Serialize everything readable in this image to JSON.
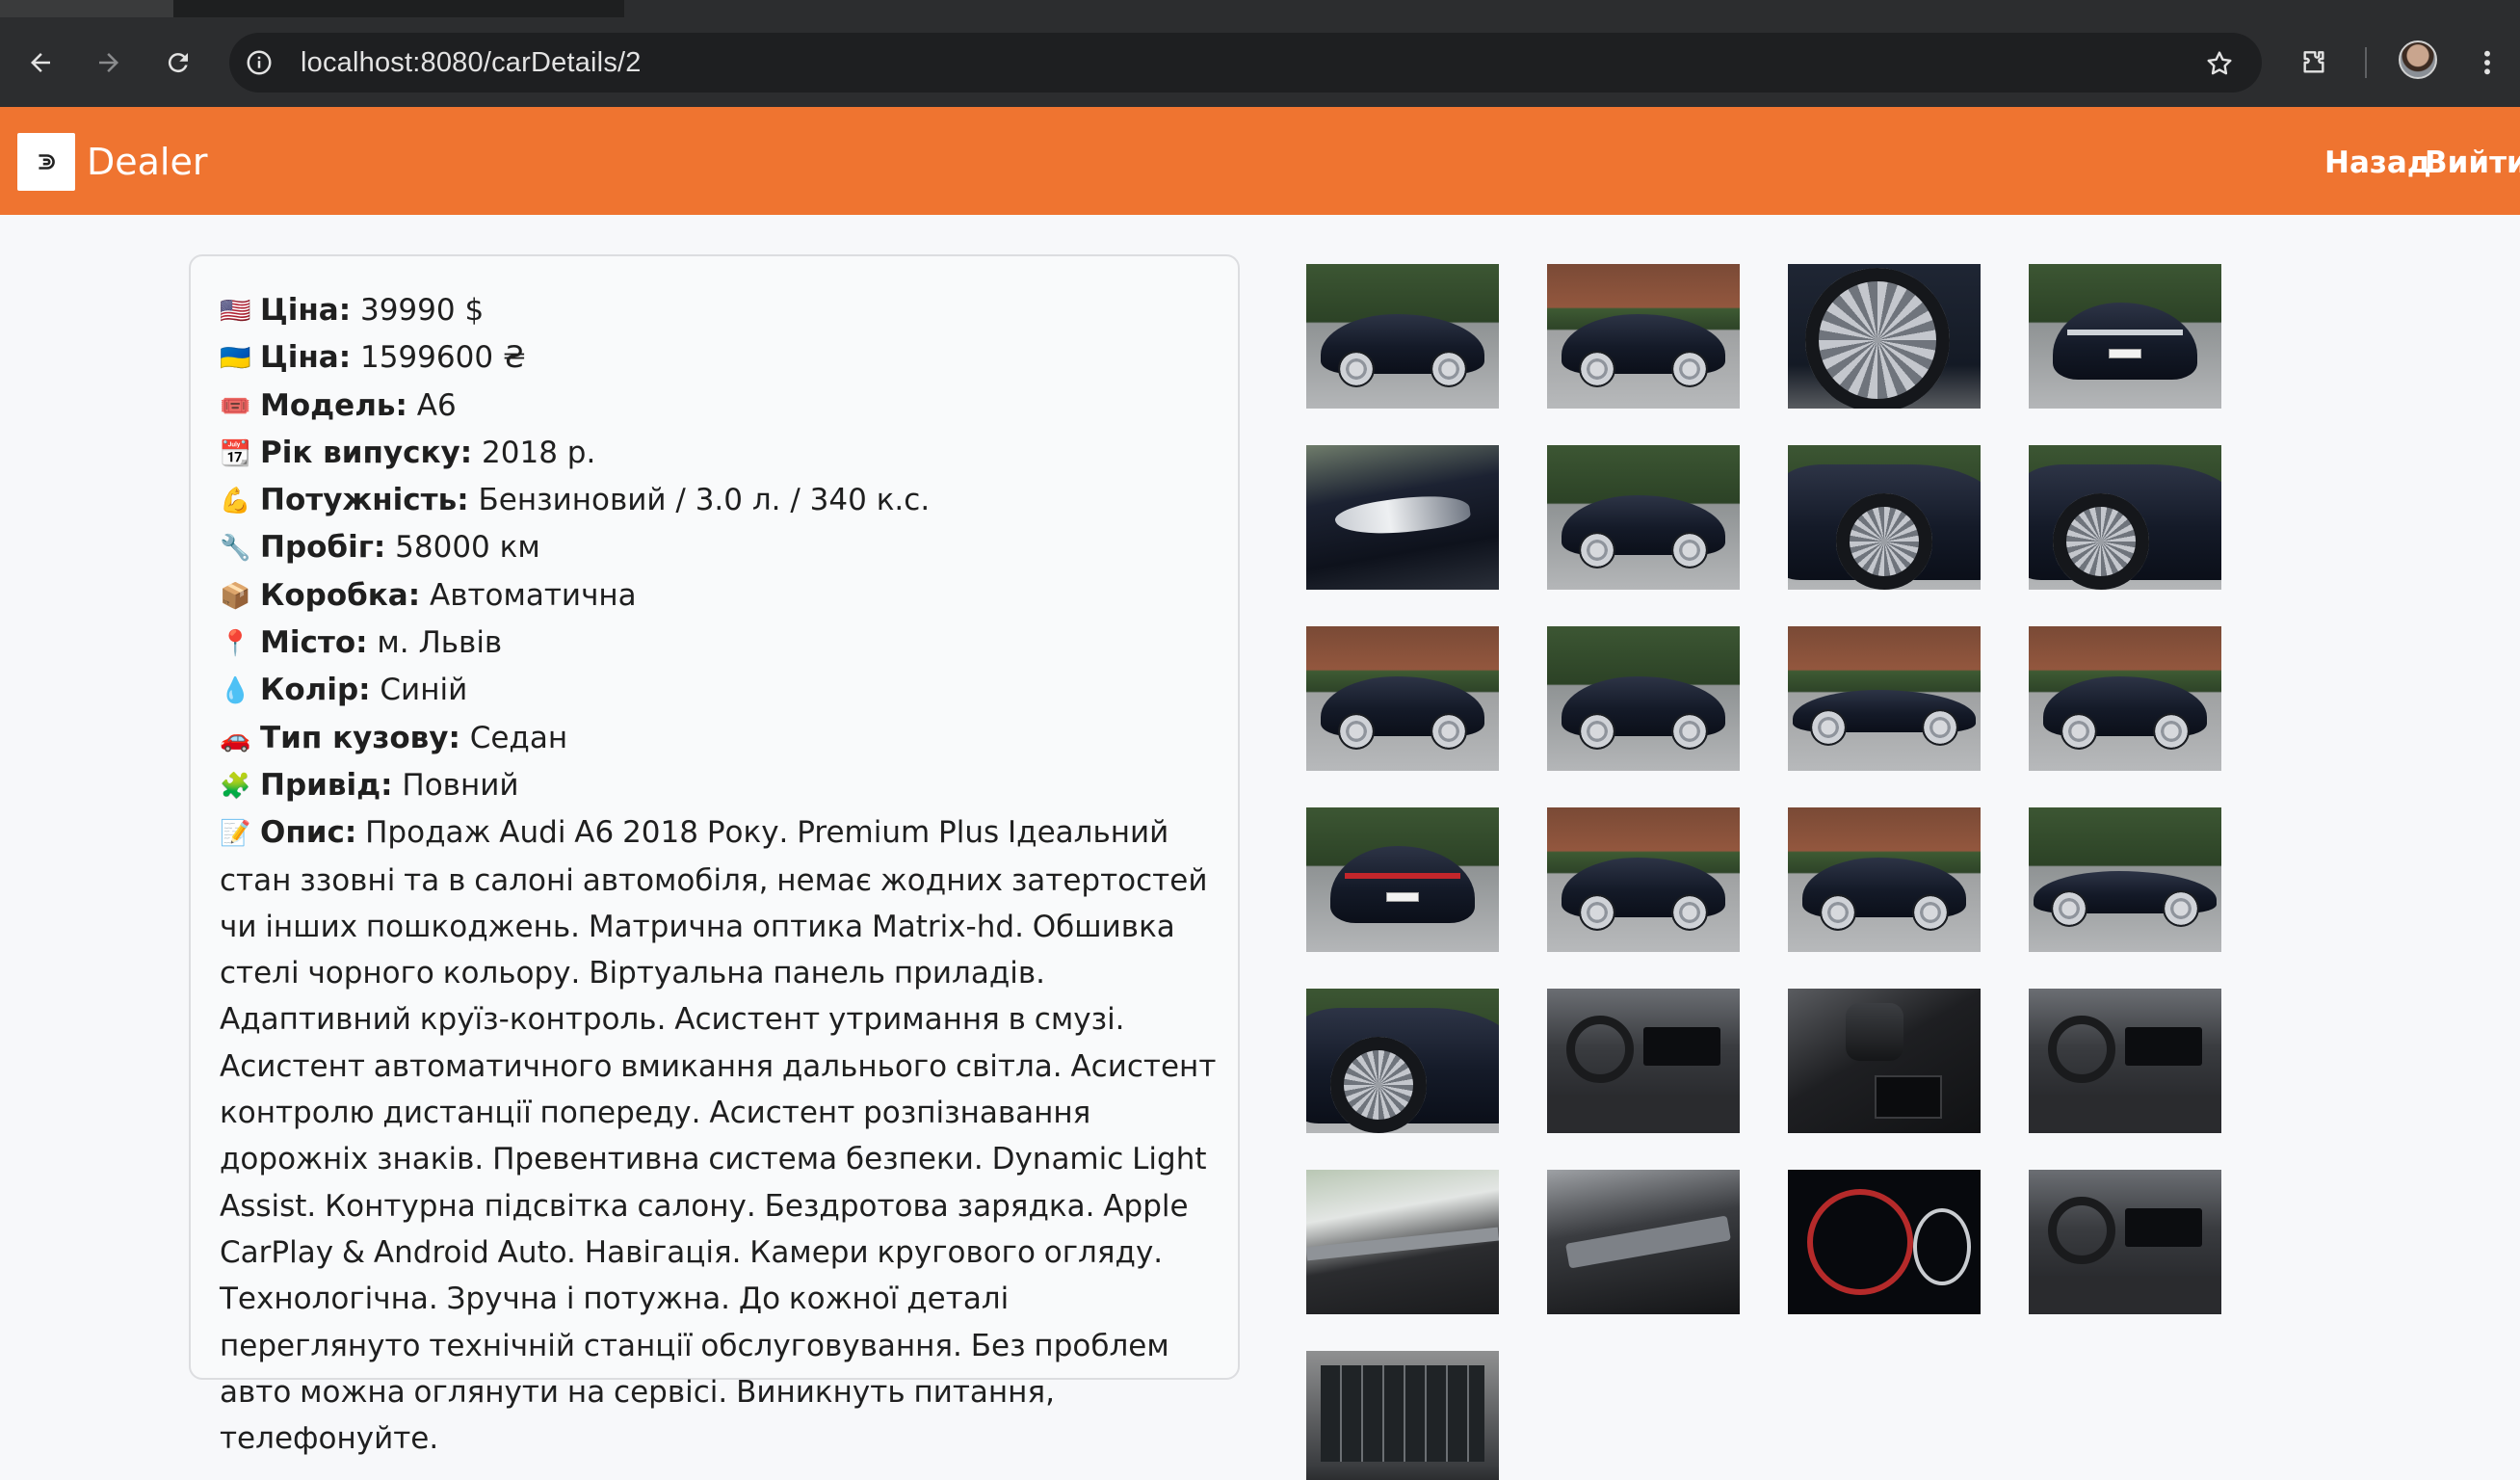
{
  "browser": {
    "url": "localhost:8080/carDetails/2"
  },
  "header": {
    "brand": "Dealer",
    "back_label": "Назад",
    "logout_label": "Вийти"
  },
  "details": {
    "rows": [
      {
        "emoji": "🇺🇸",
        "label": "Ціна:",
        "value": " 39990 $"
      },
      {
        "emoji": "🇺🇦",
        "label": "Ціна:",
        "value": " 1599600 ₴"
      },
      {
        "emoji": "🎟️",
        "label": "Модель:",
        "value": " A6"
      },
      {
        "emoji": "📆",
        "label": "Рік випуску:",
        "value": " 2018 р."
      },
      {
        "emoji": "💪",
        "label": "Потужність:",
        "value": " Бензиновий / 3.0 л. / 340 к.с."
      },
      {
        "emoji": "🔧",
        "label": "Пробіг:",
        "value": " 58000 км"
      },
      {
        "emoji": "📦",
        "label": "Коробка:",
        "value": " Автоматична"
      },
      {
        "emoji": "📍",
        "label": "Місто:",
        "value": " м. Львів"
      },
      {
        "emoji": "💧",
        "label": "Колір:",
        "value": " Синій"
      },
      {
        "emoji": "🚗",
        "label": "Тип кузову:",
        "value": " Седан"
      },
      {
        "emoji": "🧩",
        "label": "Привід:",
        "value": " Повний"
      }
    ],
    "description": {
      "emoji": "📝",
      "label": "Опис:",
      "value": " Продаж Audi A6 2018 Року. Premium Plus Ідеальний стан ззовні та в салоні автомобіля, немає жодних затертостей чи інших пошкоджень. Матрична оптика Matrix-hd. Обшивка стелі чорного кольору. Віртуальна панель приладів. Адаптивний круїз-контроль. Асистент утримання в смузі. Асистент автоматичного вмикання дальнього світла. Асистент контролю дистанції попереду. Асистент розпізнавання дорожніх знаків. Превентивна система безпеки. Dynamic Light Assist. Контурна підсвітка салону. Бездротова зарядка. Apple CarPlay & Android Auto. Навігація. Камери кругового огляду. Технологічна. Зручна і потужна. До кожної деталі переглянуто технічній станції обслуговування. Без проблем авто можна оглянути на сервісі. Виникнуть питання, телефонуйте."
    }
  },
  "gallery": {
    "photos": [
      {
        "kind": "side-front"
      },
      {
        "kind": "front-3q"
      },
      {
        "kind": "wheel"
      },
      {
        "kind": "front"
      },
      {
        "kind": "headlight"
      },
      {
        "kind": "side-front"
      },
      {
        "kind": "wheel-arch"
      },
      {
        "kind": "rear-3q-wheel"
      },
      {
        "kind": "front-3q"
      },
      {
        "kind": "front-3q"
      },
      {
        "kind": "side"
      },
      {
        "kind": "rear-3q"
      },
      {
        "kind": "rear"
      },
      {
        "kind": "rear-3q"
      },
      {
        "kind": "rear-3q"
      },
      {
        "kind": "side"
      },
      {
        "kind": "rear-3q-wheel"
      },
      {
        "kind": "interior"
      },
      {
        "kind": "console"
      },
      {
        "kind": "interior"
      },
      {
        "kind": "door-panel"
      },
      {
        "kind": "sill"
      },
      {
        "kind": "cluster"
      },
      {
        "kind": "cabin"
      },
      {
        "kind": "roof"
      }
    ]
  },
  "colors": {
    "accent": "#ef7430",
    "card_bg": "#f9fafb",
    "page_bg": "#f7f8fa",
    "chrome_bg": "#2c2d2f"
  }
}
